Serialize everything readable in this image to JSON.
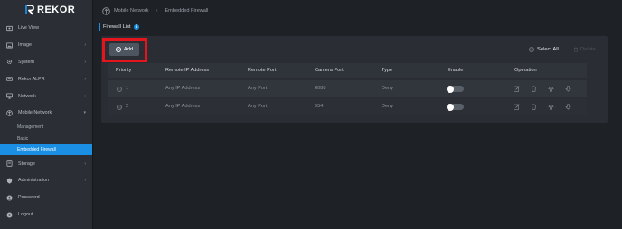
{
  "app": {
    "brand": "REKOR"
  },
  "sidebar": {
    "items": [
      {
        "label": "Live View",
        "icon": "live-view-icon",
        "chevron": ""
      },
      {
        "label": "Image",
        "icon": "image-icon",
        "chevron": "›"
      },
      {
        "label": "System",
        "icon": "gear-icon",
        "chevron": "›"
      },
      {
        "label": "Rekor ALPR",
        "icon": "alpr-icon",
        "chevron": "›"
      },
      {
        "label": "Network",
        "icon": "network-icon",
        "chevron": "›"
      },
      {
        "label": "Mobile Network",
        "icon": "mobile-network-icon",
        "chevron": "▾"
      }
    ],
    "sub_items": [
      {
        "label": "Management",
        "active": false
      },
      {
        "label": "Basic",
        "active": false
      },
      {
        "label": "Embedded Firewall",
        "active": true
      }
    ],
    "items_after": [
      {
        "label": "Storage",
        "icon": "storage-icon",
        "chevron": "›"
      },
      {
        "label": "Administration",
        "icon": "shield-icon",
        "chevron": "›"
      },
      {
        "label": "Password",
        "icon": "user-icon",
        "chevron": ""
      },
      {
        "label": "Logout",
        "icon": "power-icon",
        "chevron": ""
      }
    ]
  },
  "breadcrumb": {
    "section": "Mobile Network",
    "separator": "›",
    "page": "Embedded Firewall"
  },
  "firewall": {
    "title": "Firewall List",
    "info": "i",
    "add_label": "Add",
    "select_all_label": "Select All",
    "delete_label": "Delete",
    "columns": [
      "Priority",
      "Remote IP Address",
      "Remote Port",
      "Camera Port",
      "Type",
      "Enable",
      "Operation"
    ],
    "rows": [
      {
        "priority": "1",
        "remote_ip": "Any IP Address",
        "remote_port": "Any Port",
        "camera_port": "8088",
        "type": "Deny",
        "enabled": false
      },
      {
        "priority": "2",
        "remote_ip": "Any IP Address",
        "remote_port": "Any Port",
        "camera_port": "554",
        "type": "Deny",
        "enabled": false
      }
    ],
    "operations": [
      "edit-icon",
      "delete-icon",
      "move-up-icon",
      "move-down-icon"
    ]
  },
  "colors": {
    "accent": "#1b8fe4",
    "highlight": "#e5151d",
    "sidebar_bg": "#2b2f35",
    "page_bg": "#1e2126"
  }
}
